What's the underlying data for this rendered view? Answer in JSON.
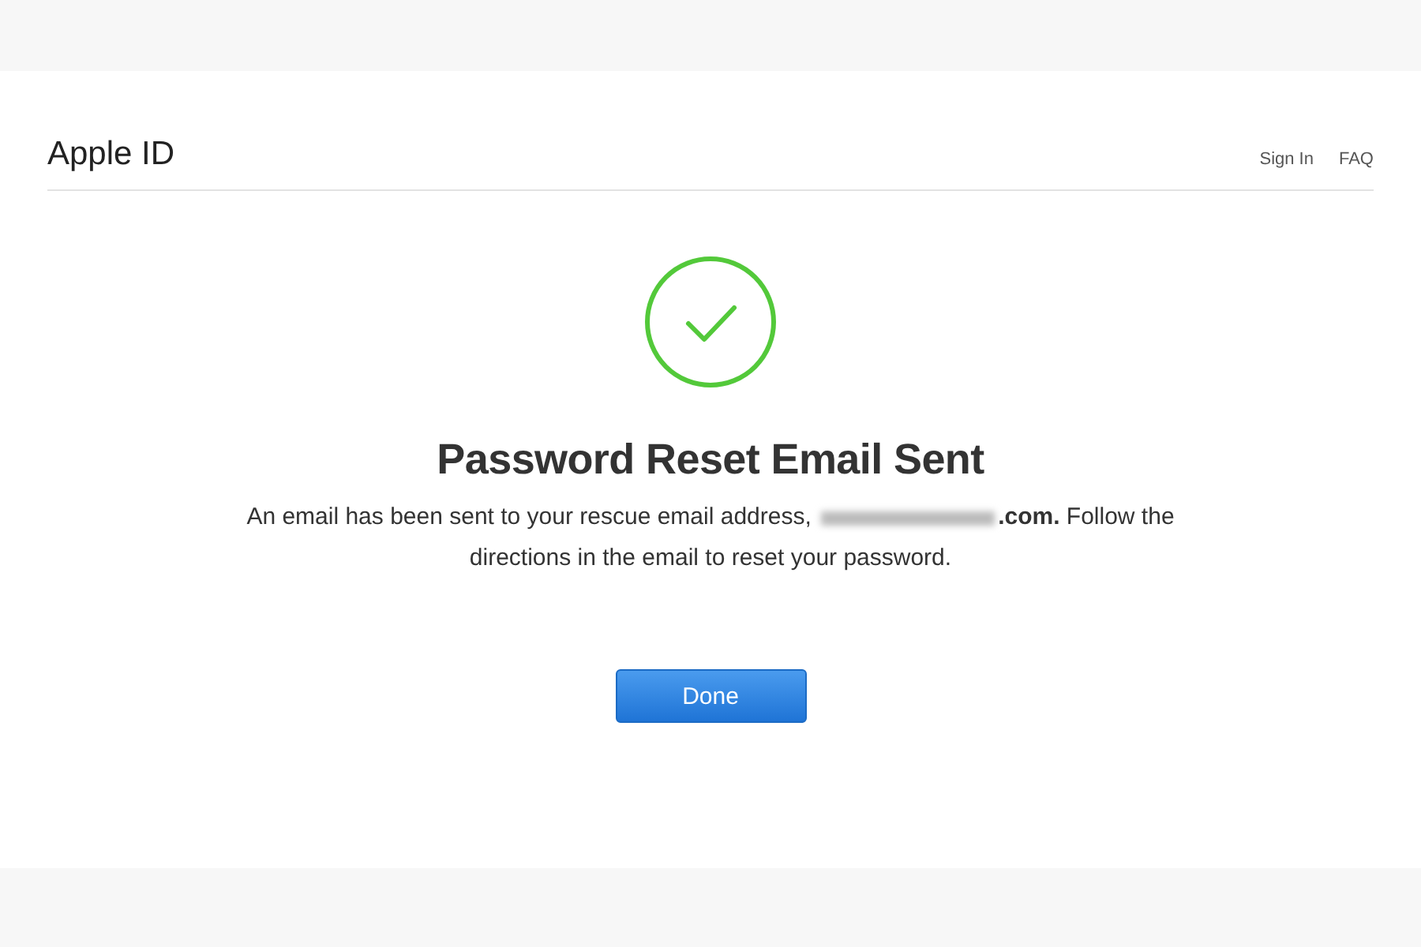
{
  "header": {
    "title": "Apple ID",
    "links": [
      "Sign In",
      "FAQ"
    ]
  },
  "confirmation": {
    "title": "Password Reset Email Sent",
    "message_lead": "An email has been sent to your rescue email address,",
    "email_redacted": true,
    "message_tail": "**.com.** Follow the directions in the email to reset your password."
  },
  "buttons": [
    "Done"
  ]
}
